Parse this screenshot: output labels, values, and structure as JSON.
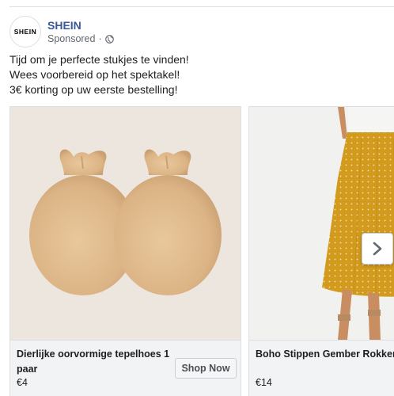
{
  "post": {
    "page_name": "SHEIN",
    "avatar_text": "SHEIN",
    "sponsored": "Sponsored",
    "separator": "·",
    "privacy_icon": "globe-icon",
    "text_lines": [
      "Tijd om je perfecte stukjes te vinden!",
      "Wees voorbereid op het spektakel!",
      "3€ korting op uw eerste bestelling!"
    ]
  },
  "carousel": {
    "cards": [
      {
        "title": "Dierlijke oorvormige tepelhoes 1 paar",
        "price": "€4",
        "cta": "Shop Now",
        "image": "nipple-covers-product-image"
      },
      {
        "title": "Boho Stippen Gember Rokken",
        "price": "€14",
        "image": "polka-dot-skirt-product-image"
      }
    ],
    "next_icon": "chevron-right-icon"
  },
  "colors": {
    "brand_link": "#385898",
    "meta_text": "#616770",
    "card_bg": "#f2f3f5",
    "skirt_mustard": "#d39b1e"
  }
}
